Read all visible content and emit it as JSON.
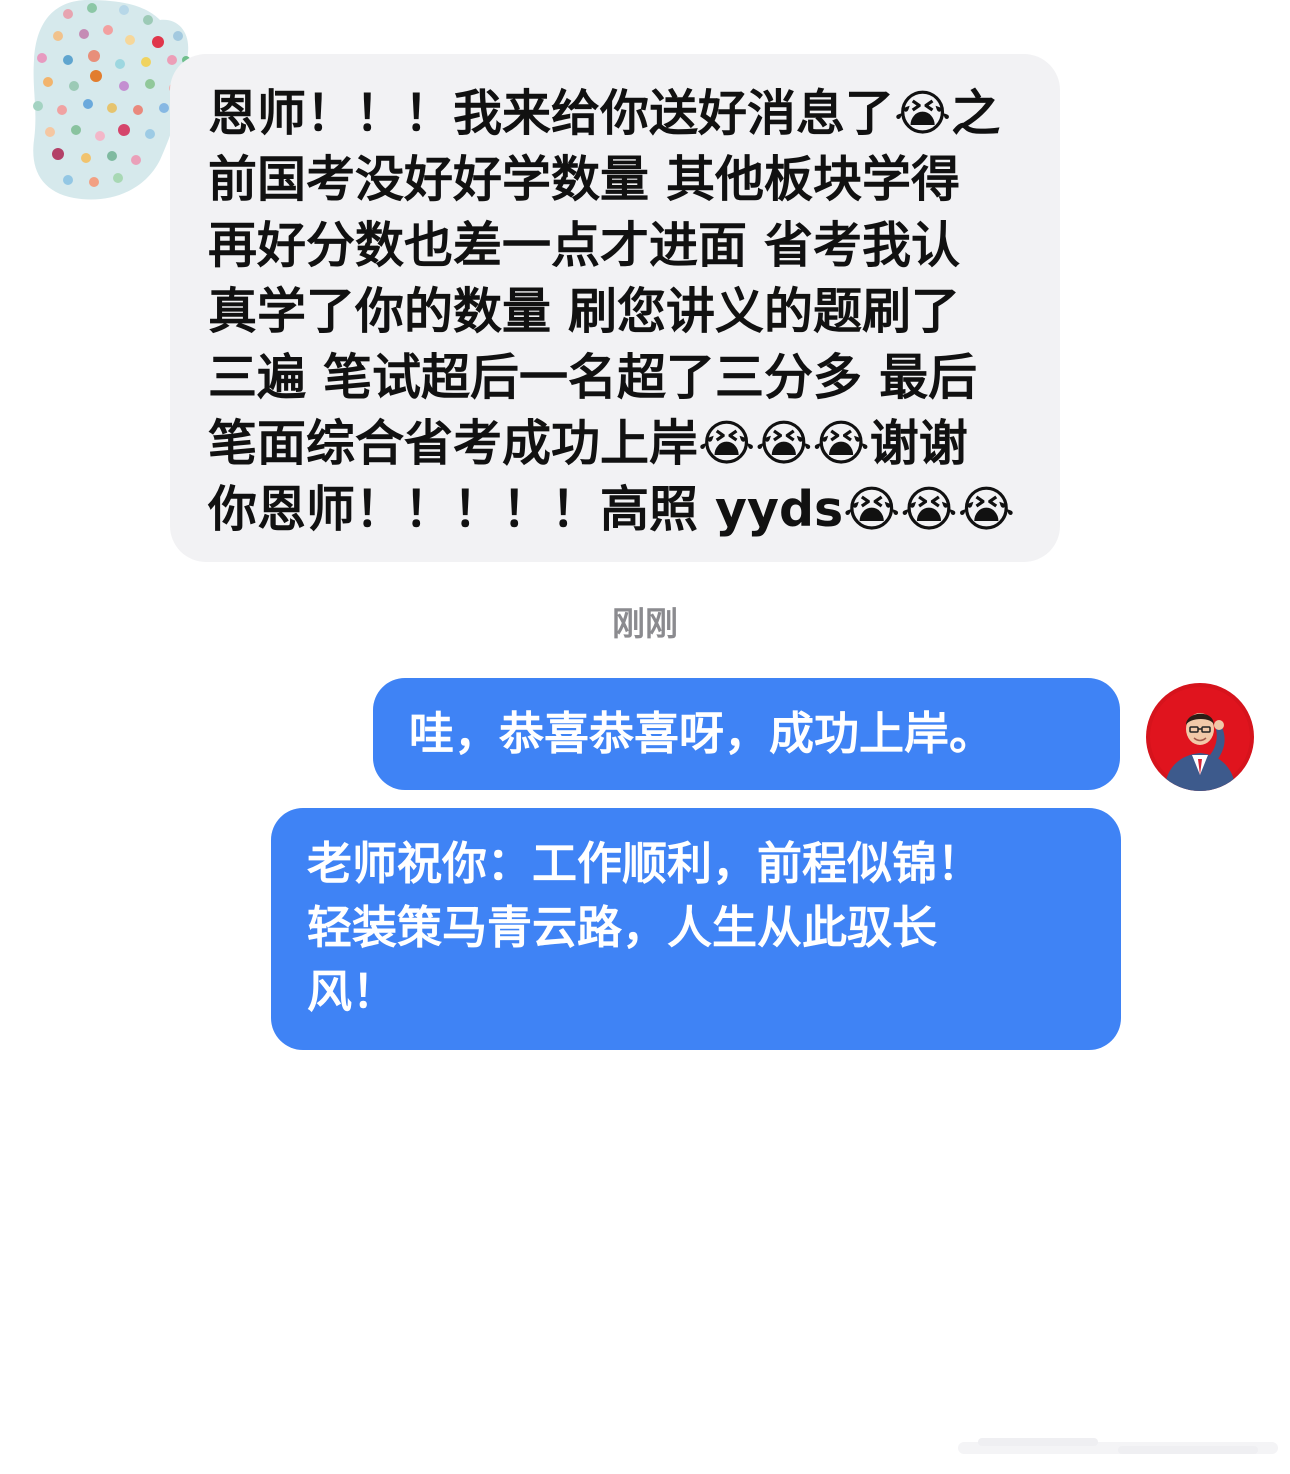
{
  "incoming": {
    "message": "恩师！！！我来给你送好消息了😭之\n前国考没好好学数量 其他板块学得\n再好分数也差一点才进面 省考我认\n真学了你的数量 刷您讲义的题刷了\n三遍 笔试超后一名超了三分多 最后\n笔面综合省考成功上岸😭😭😭谢谢\n你恩师！！！！！高照 yyds😭😭😭",
    "avatar_icon": "polka-dot-avatar-icon"
  },
  "timestamp": "刚刚",
  "outgoing": [
    {
      "message": "哇，恭喜恭喜呀，成功上岸。"
    },
    {
      "message": "老师祝你：工作顺利，前程似锦！\n轻装策马青云路，人生从此驭长\n风！"
    }
  ],
  "teacher_avatar": {
    "icon": "teacher-portrait-avatar",
    "background_color": "#d6131c"
  },
  "colors": {
    "incoming_bubble": "#f2f2f4",
    "outgoing_bubble": "#3f83f5",
    "timestamp": "#8b8b8f"
  }
}
